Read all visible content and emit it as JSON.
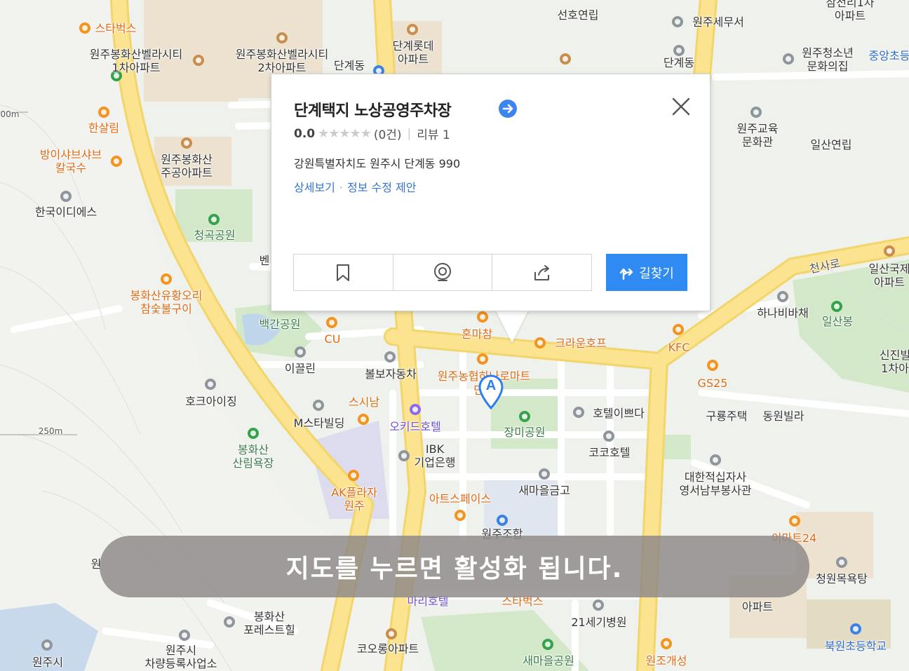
{
  "popup": {
    "title": "단계택지 노상공영주차장",
    "rating_score": "0.0",
    "rating_stars": "★★★★★",
    "rating_count": "(0건)",
    "review": "리뷰 1",
    "address": "강원특별자치도 원주시 단계동 990",
    "link_detail": "상세보기",
    "link_separator": "·",
    "link_suggest": "정보 수정 제안",
    "route_label": "길찾기"
  },
  "toast": {
    "message": "지도를 누르면 활성화 됩니다."
  },
  "marker": {
    "letter": "A"
  },
  "scale": {
    "label_top": "00m",
    "label_mid": "250m"
  },
  "colors": {
    "road": "#fbe38f",
    "park": "#d3e8c9",
    "apartment": "#ece2cf",
    "accent": "#2f8bf2",
    "food": "#e06a12"
  },
  "map_labels": {
    "starbucks_top": "스타벅스",
    "bonghwasan_villa1": "원주봉화산벨라시티\n1차아파트",
    "bonghwasan_villa2": "원주봉화산벨라시티\n2차아파트",
    "dangyedong_top": "단계동",
    "dangye_lotte": "단계롯데\n아파트",
    "seonho": "선호연립",
    "tax_office": "원주세무서",
    "dangyedong_dot": "단계동",
    "youth_center": "원주청소년\n문화의집",
    "jungang_school": "중앙초등",
    "samjeon": "삼전리1차\n아파트",
    "hansalim": "한살림",
    "bangi_shabu": "방이샤브샤브\n칼국수",
    "jugong_apt": "원주봉화산\n주공아파트",
    "education_center": "원주교육\n문화관",
    "ilsan_villa": "일산연립",
    "korea_ides": "한국이디에스",
    "cheonggok_park": "청곡공원",
    "ben": "벤",
    "bonghwasan_duck": "봉화산유황오리\n참숯불구이",
    "baekgan_park": "백간공원",
    "cu": "CU",
    "honmacham": "혼마참",
    "crown_hof": "크라운호프",
    "kfc": "KFC",
    "cheonsa_ro": "천사로",
    "ilsan_apt": "일산국제\n아파트",
    "hana_bibimchae": "하나비바채",
    "ilsanbong": "일산봉",
    "sinjin": "신진빌\n1차아",
    "ikkeulin": "이끌린",
    "bolbo_auto": "볼보자동차",
    "nonghyup_mart": "원주농협하나로마트\n단계",
    "gs25": "GS25",
    "hawk_eye": "호크아이징",
    "sushinam": "스시남",
    "m_star": "M스타빌딩",
    "orchid_hotel": "오키드호텔",
    "jangmi_park": "장미공원",
    "hotel_ippeuda": "호텔이쁘다",
    "guryong": "구룡주택",
    "dongwon_villa": "동원빌라",
    "bonghwasan_forest": "봉화산\n산림욕장",
    "ibk": "IBK\n기업은행",
    "coco_hotel": "코코호텔",
    "ak_plaza": "AK플라자\n원주",
    "saemaeul": "새마을금고",
    "art_space": "아트스페이스",
    "redcross": "대한적십자사\n영서남부봉사관",
    "wonju_jo": "원주조합",
    "mart24": "이마트24",
    "cheongwon_bath": "청원목욕탕",
    "mari_hotel": "마리호텔",
    "starbucks_bottom": "스타벅스",
    "hospital21": "21세기병원",
    "won_apt": "아파트",
    "bonghwasan_forest_hill": "봉화산\n포레스트힐",
    "car_registry": "원주시\n차량등록사업소",
    "wonju_si": "원주시",
    "kolon_apt": "코오롱아파트",
    "saemaeul_park": "새마을공원",
    "wonjo_gaeseong": "원조개성",
    "bukwon_school": "북원초등학교",
    "won_left": "원"
  }
}
